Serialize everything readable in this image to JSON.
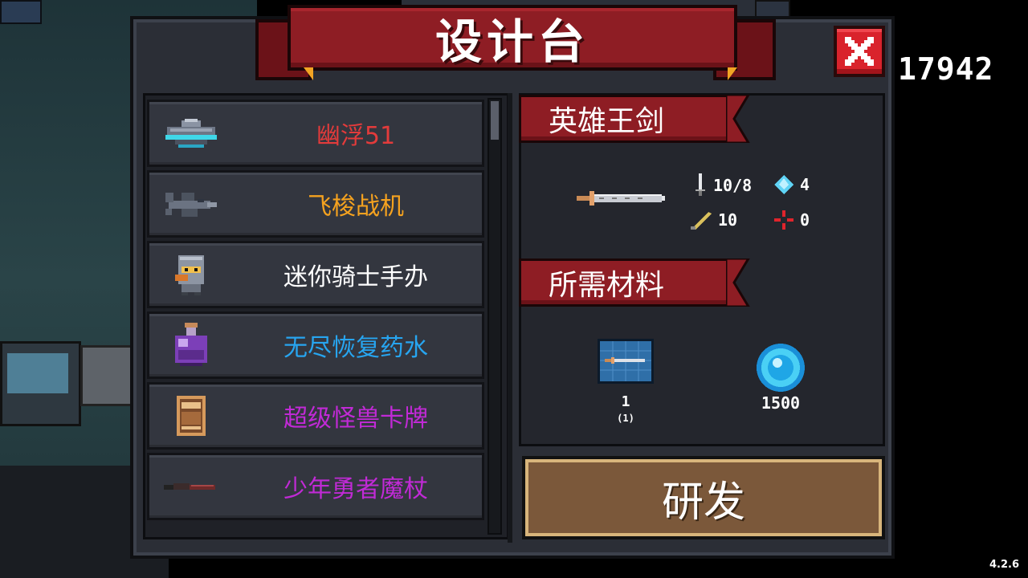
{
  "title": "设计台",
  "currency": "17942",
  "version": "4.2.6",
  "colors": {
    "ribbon": "#8e1d24",
    "panel": "#2b2e36",
    "button": "#7b583a"
  },
  "items": [
    {
      "label": "幽浮51",
      "color": "#e33b3b",
      "icon": "ufo-icon"
    },
    {
      "label": "飞梭战机",
      "color": "#f5a21f",
      "icon": "jet-icon"
    },
    {
      "label": "迷你骑士手办",
      "color": "#ffffff",
      "icon": "knight-figure-icon"
    },
    {
      "label": "无尽恢复药水",
      "color": "#27a5f0",
      "icon": "potion-icon"
    },
    {
      "label": "超级怪兽卡牌",
      "color": "#c12ad6",
      "icon": "card-icon"
    },
    {
      "label": "少年勇者魔杖",
      "color": "#c12ad6",
      "icon": "wand-icon"
    }
  ],
  "selected": {
    "name": "英雄王剑",
    "stats": {
      "damage": "10/8",
      "energy": "4",
      "crit": "10",
      "accuracy": "0"
    }
  },
  "materials": {
    "header": "所需材料",
    "blueprint_count": "1",
    "blueprint_owned": "(1)",
    "gems": "1500"
  },
  "develop_label": "研发"
}
